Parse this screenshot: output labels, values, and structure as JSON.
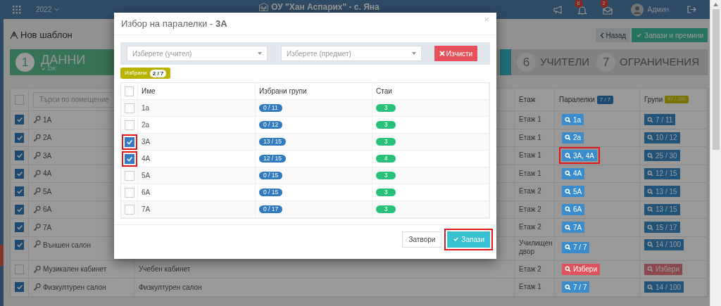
{
  "topbar": {
    "year": "2022",
    "school": "ОУ \"Хан Аспарих\" - с. Яна",
    "notifications": "6",
    "messages": "2",
    "user": "Админ"
  },
  "page": {
    "title": "Нов шаблон",
    "buttons": [
      {
        "label": "Назад",
        "kind": "back"
      },
      {
        "label": "Запази и премини",
        "kind": "save"
      }
    ]
  },
  "steps": [
    {
      "number": "1",
      "label": "ДАННИ",
      "status": "OK",
      "kind": "done"
    },
    {
      "kind": "current"
    },
    {
      "number": "6",
      "label": "УЧИТЕЛИ",
      "kind": "todo"
    },
    {
      "number": "7",
      "label": "ОГРАНИЧЕНИЯ",
      "kind": "todo"
    }
  ],
  "rooms": {
    "all_checked": false,
    "search_placeholder": "Търси по помещение",
    "floor_header": "Етаж",
    "classes_header": "Паралелки",
    "classes_count": "7 / 7",
    "groups_header": "Групи",
    "groups_count": "97 / 100",
    "rows": [
      {
        "checked": true,
        "name": "1А",
        "floor": "Етаж 1",
        "classes": {
          "label": "1а",
          "kind": "view",
          "highlighted": false
        },
        "groups": {
          "label": "7 / 11",
          "kind": "view"
        }
      },
      {
        "checked": true,
        "name": "2А",
        "floor": "Етаж 1",
        "classes": {
          "label": "2а",
          "kind": "view",
          "highlighted": false
        },
        "groups": {
          "label": "10 / 12",
          "kind": "view"
        }
      },
      {
        "checked": true,
        "name": "3А",
        "floor": "Етаж 1",
        "classes": {
          "label": "3А, 4А",
          "kind": "view",
          "highlighted": true
        },
        "groups": {
          "label": "25 / 30",
          "kind": "view"
        }
      },
      {
        "checked": true,
        "name": "4А",
        "floor": "Етаж 1",
        "classes": {
          "label": "4А",
          "kind": "view",
          "highlighted": false
        },
        "groups": {
          "label": "12 / 15",
          "kind": "view"
        }
      },
      {
        "checked": true,
        "name": "5А",
        "floor": "Етаж 2",
        "classes": {
          "label": "5А",
          "kind": "view",
          "highlighted": false
        },
        "groups": {
          "label": "13 / 15",
          "kind": "view"
        }
      },
      {
        "checked": true,
        "name": "6А",
        "floor": "Етаж 2",
        "classes": {
          "label": "6А",
          "kind": "view",
          "highlighted": false
        },
        "groups": {
          "label": "13 / 15",
          "kind": "view"
        }
      },
      {
        "checked": true,
        "name": "7А",
        "floor": "Етаж 2",
        "classes": {
          "label": "7А",
          "kind": "view",
          "highlighted": false
        },
        "groups": {
          "label": "15 / 17",
          "kind": "view"
        }
      },
      {
        "checked": true,
        "name": "Външен салон",
        "floor": "Училищен двор",
        "classes": {
          "label": "7 / 7",
          "kind": "view",
          "highlighted": false
        },
        "groups": {
          "label": "14 / 100",
          "kind": "view"
        }
      },
      {
        "checked": false,
        "name": "Музикален кабинет",
        "type": "Учебен кабинет",
        "floor": "Етаж 2",
        "classes": {
          "label": "Избери",
          "kind": "choose",
          "highlighted": false
        },
        "groups": {
          "label": "Избери",
          "kind": "choose-disabled"
        }
      },
      {
        "checked": true,
        "name": "Физкултурен салон",
        "type": "Физкултурен салон",
        "floor": "Етаж 1",
        "classes": {
          "label": "7 / 7",
          "kind": "view",
          "highlighted": false
        },
        "groups": {
          "label": "14 / 100",
          "kind": "view"
        }
      }
    ]
  },
  "modal": {
    "title": "Избор на паралелки - **3А**",
    "close": "×",
    "teacher_placeholder": "Изберете (учител)",
    "subject_placeholder": "Изберете (предмет)",
    "clear_button": "Изчисти",
    "selected_label": "Избрани",
    "selected_count": "2 / 7",
    "columns": [
      "Име",
      "Избрани групи",
      "Стаи"
    ],
    "all_checked": false,
    "rows": [
      {
        "name": "1а",
        "groups": "0 / 11",
        "rooms": "3",
        "checked": false,
        "highlighted": false
      },
      {
        "name": "2а",
        "groups": "0 / 12",
        "rooms": "3",
        "checked": false,
        "highlighted": false
      },
      {
        "name": "3А",
        "groups": "13 / 15",
        "rooms": "3",
        "checked": true,
        "highlighted": true
      },
      {
        "name": "4А",
        "groups": "12 / 15",
        "rooms": "4",
        "checked": true,
        "highlighted": true
      },
      {
        "name": "5А",
        "groups": "0 / 15",
        "rooms": "3",
        "checked": false,
        "highlighted": false
      },
      {
        "name": "6А",
        "groups": "0 / 15",
        "rooms": "3",
        "checked": false,
        "highlighted": false
      },
      {
        "name": "7А",
        "groups": "0 / 17",
        "rooms": "3",
        "checked": false,
        "highlighted": false
      }
    ],
    "buttons": [
      {
        "label": "Затвори",
        "kind": "close",
        "highlighted": false
      },
      {
        "label": "Запази",
        "kind": "save",
        "highlighted": true
      }
    ]
  }
}
